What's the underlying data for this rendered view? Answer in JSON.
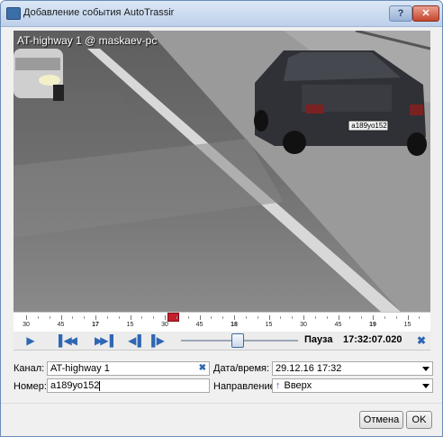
{
  "window": {
    "title": "Добавление события AutoTrassir",
    "help_glyph": "?",
    "close_glyph": "✕"
  },
  "video": {
    "camera_label": "AT-highway 1 @ maskaev-pc",
    "plate_text": "а189уо152"
  },
  "timeline": {
    "ticks": [
      {
        "label": "30",
        "major": false
      },
      {
        "label": "45",
        "major": false
      },
      {
        "label": "17",
        "major": true
      },
      {
        "label": "15",
        "major": false
      },
      {
        "label": "30",
        "major": false
      },
      {
        "label": "45",
        "major": false
      },
      {
        "label": "18",
        "major": true
      },
      {
        "label": "15",
        "major": false
      },
      {
        "label": "30",
        "major": false
      },
      {
        "label": "45",
        "major": false
      },
      {
        "label": "19",
        "major": true
      },
      {
        "label": "15",
        "major": false
      }
    ]
  },
  "controls": {
    "status": "Пауза",
    "time": "17:32:07.020"
  },
  "form": {
    "channel_label": "Канал:",
    "channel_value": "AT-highway 1",
    "number_label": "Номер:",
    "number_value": "а189уо152",
    "datetime_label": "Дата/время:",
    "datetime_value": "29.12.16 17:32",
    "direction_label": "Направление:",
    "direction_value": "Вверх"
  },
  "buttons": {
    "cancel": "Отмена",
    "ok": "OK"
  },
  "icons": {
    "play": "play-icon",
    "skip_back": "skip-back-icon",
    "skip_forward": "skip-forward-icon",
    "step_back": "step-back-icon",
    "step_forward": "step-forward-icon",
    "clear": "clear-icon",
    "direction": "arrow-up-icon"
  },
  "colors": {
    "accent": "#2e67b4",
    "marker": "#c41e2a"
  }
}
